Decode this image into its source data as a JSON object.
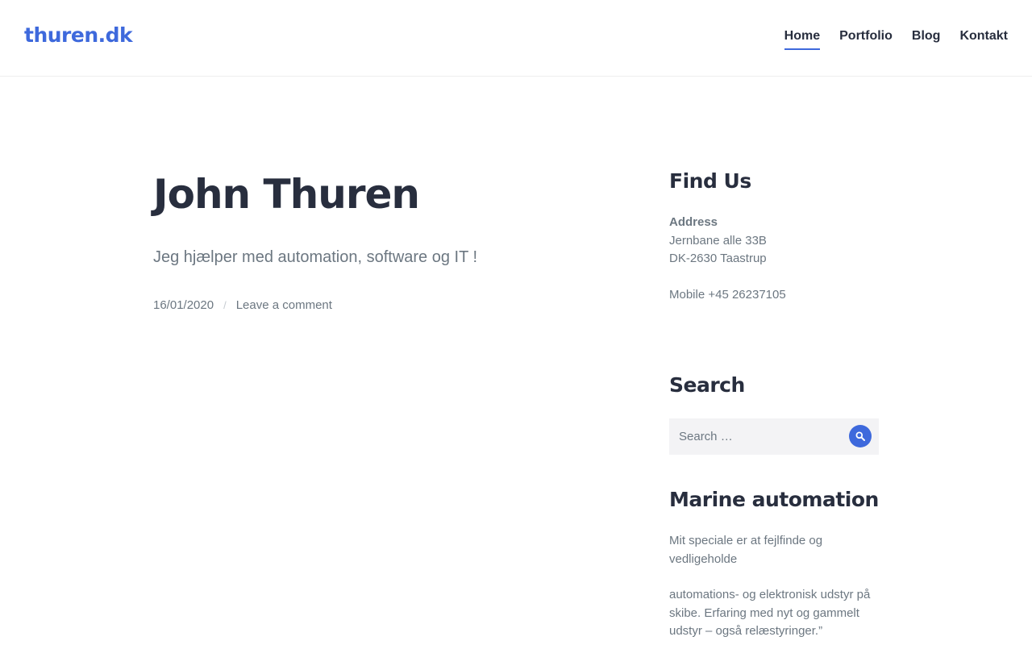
{
  "site": {
    "logo": "thuren.dk"
  },
  "nav": {
    "items": [
      {
        "label": "Home",
        "active": true
      },
      {
        "label": "Portfolio",
        "active": false
      },
      {
        "label": "Blog",
        "active": false
      },
      {
        "label": "Kontakt",
        "active": false
      }
    ]
  },
  "post": {
    "title": "John Thuren",
    "tagline": "Jeg hjælper med automation, software og IT !",
    "date": "16/01/2020",
    "separator": "/",
    "comment_link": "Leave a comment"
  },
  "sidebar": {
    "find_us": {
      "title": "Find Us",
      "address_label": "Address",
      "address_line1": "Jernbane alle 33B",
      "address_line2": "DK-2630 Taastrup",
      "mobile": "Mobile +45 26237105"
    },
    "search": {
      "title": "Search",
      "placeholder": "Search …",
      "button_icon": "search-icon"
    },
    "marine": {
      "title": "Marine automation",
      "paragraph1": "Mit speciale er at fejlfinde og vedligeholde",
      "paragraph2": "automations- og elektronisk udstyr på skibe. Erfaring med nyt og gammelt udstyr – også relæstyringer.”"
    }
  },
  "colors": {
    "accent": "#3e69dc",
    "heading": "#282e3e",
    "text": "#6c7781"
  }
}
